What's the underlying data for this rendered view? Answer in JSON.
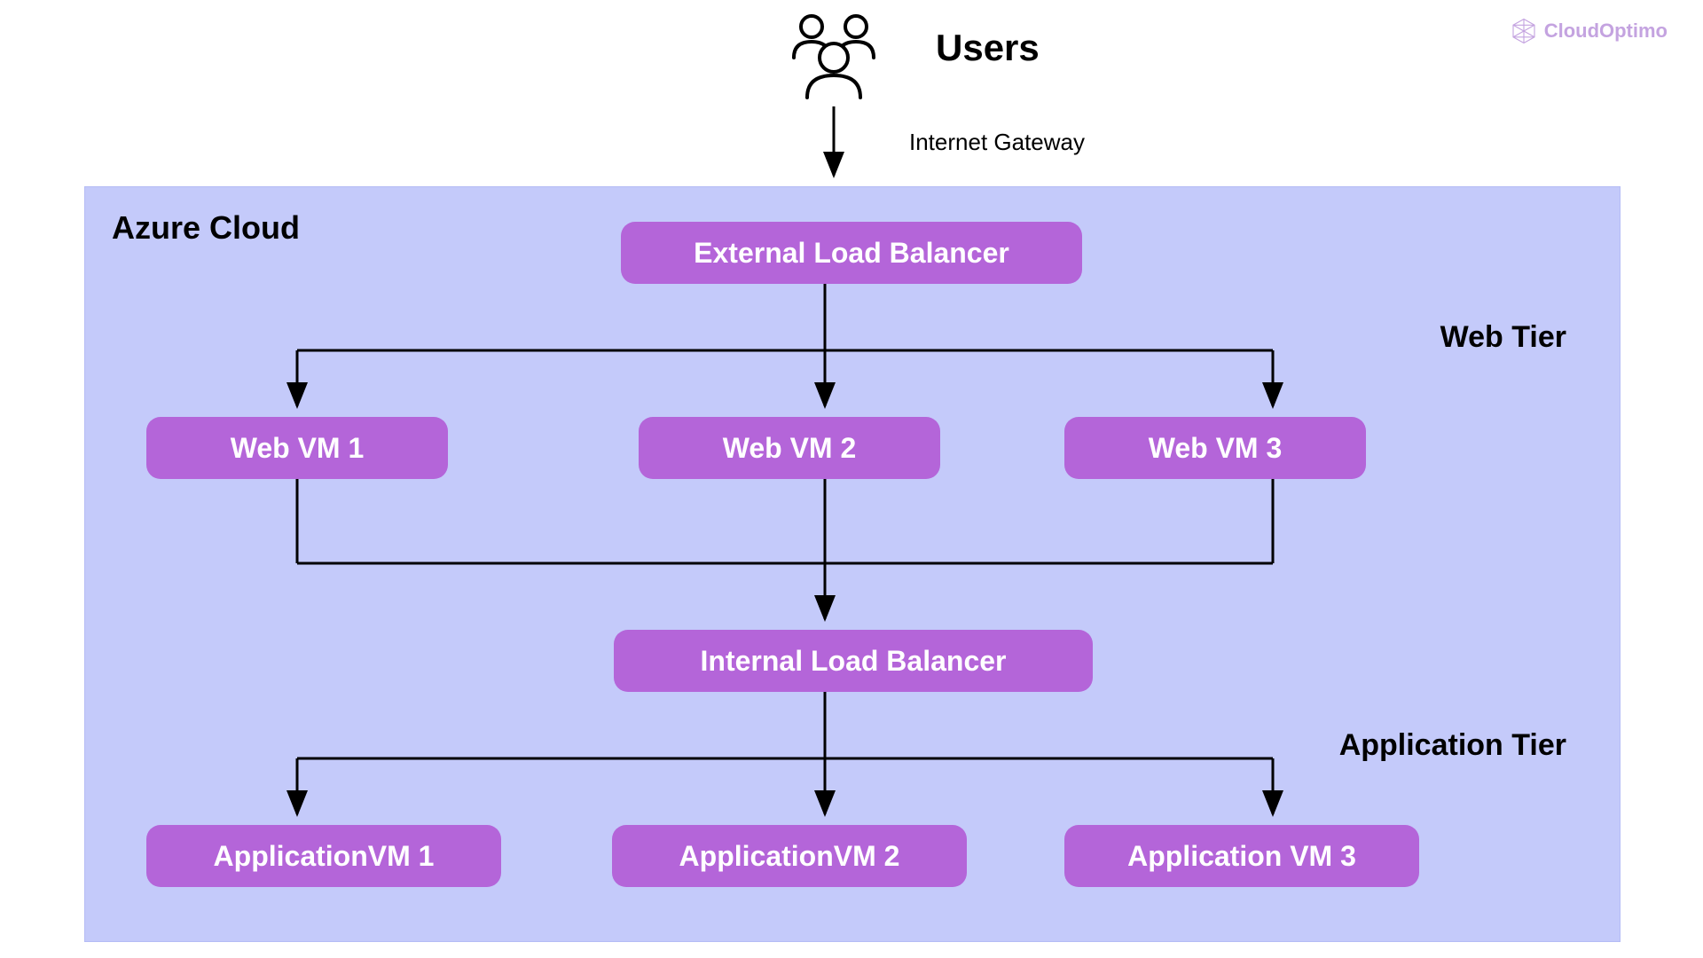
{
  "brand": "CloudOptimo",
  "users_label": "Users",
  "gateway_label": "Internet Gateway",
  "cloud_title": "Azure Cloud",
  "web_tier_label": "Web Tier",
  "app_tier_label": "Application Tier",
  "nodes": {
    "ext_lb": "External Load Balancer",
    "web_vm1": "Web VM 1",
    "web_vm2": "Web VM 2",
    "web_vm3": "Web VM 3",
    "int_lb": "Internal Load Balancer",
    "app_vm1": "ApplicationVM 1",
    "app_vm2": "ApplicationVM 2",
    "app_vm3": "Application VM 3"
  }
}
